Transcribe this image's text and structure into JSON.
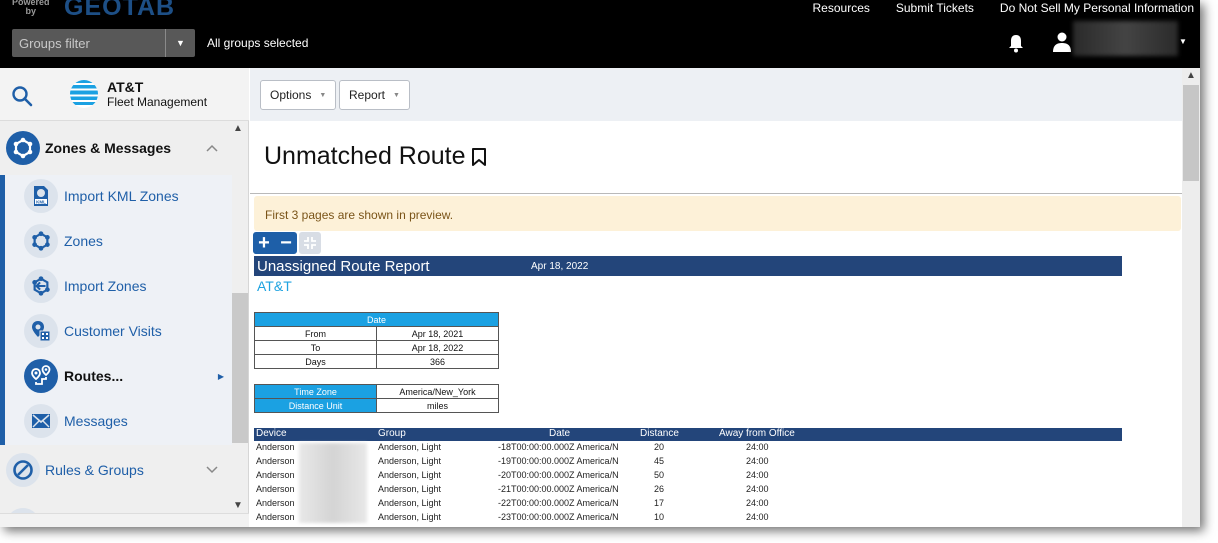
{
  "topbar": {
    "powered_by": "Powered by",
    "brand": "GEOTAB",
    "groups_filter_placeholder": "Groups filter",
    "groups_status": "All groups selected",
    "links": [
      "Resources",
      "Submit Tickets",
      "Do Not Sell My Personal Information"
    ],
    "icons": {
      "notifications": "bell-icon",
      "user": "user-icon"
    }
  },
  "sidebar": {
    "logo_title": "AT&T",
    "logo_subtitle": "Fleet Management",
    "expanded_group": {
      "label": "Zones & Messages",
      "icon": "zones-icon",
      "items": [
        {
          "label": "Import KML Zones",
          "icon": "kml-file-icon"
        },
        {
          "label": "Zones",
          "icon": "zones-icon"
        },
        {
          "label": "Import Zones",
          "icon": "import-zones-icon"
        },
        {
          "label": "Customer Visits",
          "icon": "customer-visits-icon"
        },
        {
          "label": "Routes...",
          "icon": "routes-icon",
          "active": true
        },
        {
          "label": "Messages",
          "icon": "envelope-icon"
        }
      ]
    },
    "collapsed_group": {
      "label": "Rules & Groups",
      "icon": "rules-icon"
    }
  },
  "toolbar": {
    "options_label": "Options",
    "report_label": "Report"
  },
  "page": {
    "title": "Unmatched Route",
    "preview_note": "First 3 pages are shown in preview."
  },
  "report": {
    "title": "Unassigned Route Report",
    "date": "Apr 18, 2022",
    "company": "AT&T",
    "date_table": {
      "header": "Date",
      "rows": [
        {
          "label": "From",
          "value": "Apr 18, 2021"
        },
        {
          "label": "To",
          "value": "Apr 18, 2022"
        },
        {
          "label": "Days",
          "value": "366"
        }
      ]
    },
    "settings_table": [
      {
        "label": "Time Zone",
        "value": "America/New_York"
      },
      {
        "label": "Distance Unit",
        "value": "miles"
      }
    ],
    "columns": [
      "Device",
      "Group",
      "Date",
      "Distance",
      "Away from Office"
    ],
    "rows": [
      {
        "device": "Anderson",
        "group": "Anderson, Light",
        "date": "-18T00:00:00.000Z America/N",
        "distance": "20",
        "away": "24:00"
      },
      {
        "device": "Anderson",
        "group": "Anderson, Light",
        "date": "-19T00:00:00.000Z America/N",
        "distance": "45",
        "away": "24:00"
      },
      {
        "device": "Anderson",
        "group": "Anderson, Light",
        "date": "-20T00:00:00.000Z America/N",
        "distance": "50",
        "away": "24:00"
      },
      {
        "device": "Anderson",
        "group": "Anderson, Light",
        "date": "-21T00:00:00.000Z America/N",
        "distance": "26",
        "away": "24:00"
      },
      {
        "device": "Anderson",
        "group": "Anderson, Light",
        "date": "-22T00:00:00.000Z America/N",
        "distance": "17",
        "away": "24:00"
      },
      {
        "device": "Anderson",
        "group": "Anderson, Light",
        "date": "-23T00:00:00.000Z America/N",
        "distance": "10",
        "away": "24:00"
      }
    ]
  },
  "colors": {
    "brand_blue": "#1f5fa8",
    "report_header": "#23457a",
    "table_header": "#1ba1e2",
    "notice_bg": "#fdf1d8"
  }
}
